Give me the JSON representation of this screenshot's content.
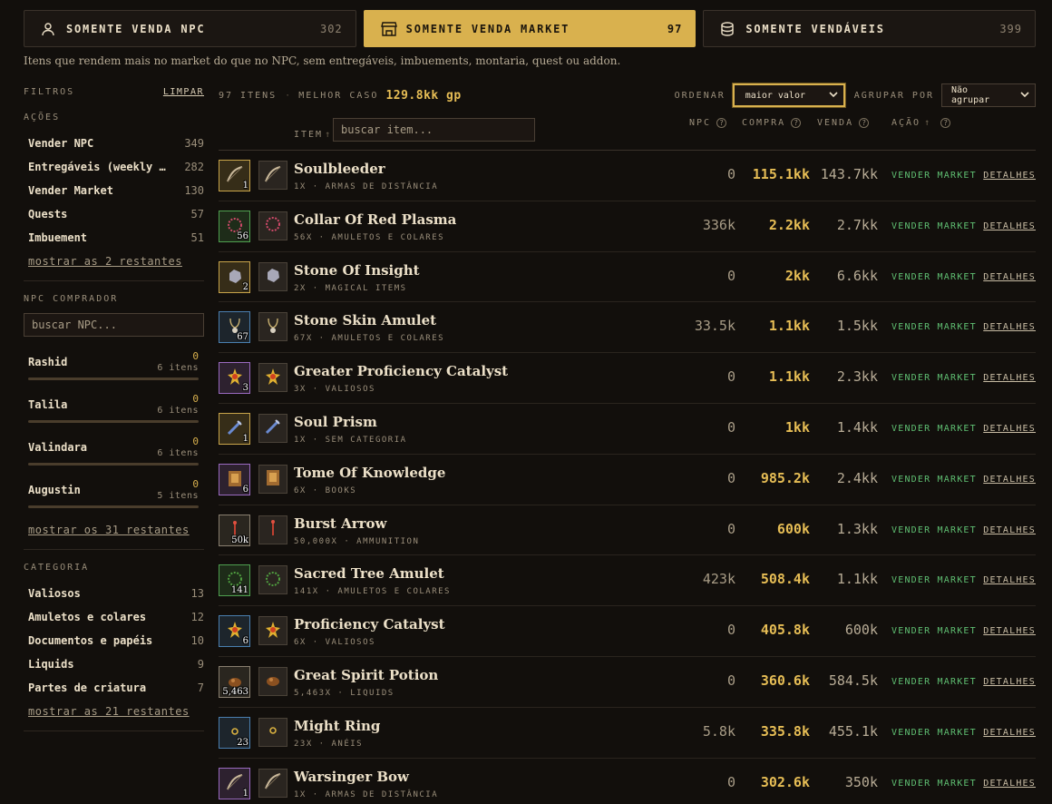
{
  "tabs": [
    {
      "label": "SOMENTE VENDA NPC",
      "count": "302",
      "icon": "user-icon",
      "active": false
    },
    {
      "label": "SOMENTE VENDA MARKET",
      "count": "97",
      "icon": "store-icon",
      "active": true
    },
    {
      "label": "SOMENTE VENDÁVEIS",
      "count": "399",
      "icon": "database-icon",
      "active": false
    }
  ],
  "subtitle": "Itens que rendem mais no market do que no NPC, sem entregáveis, imbuements, montaria, quest ou addon.",
  "sidebar": {
    "filters_title": "FILTROS",
    "clear_label": "LIMPAR",
    "actions": {
      "title": "AÇÕES",
      "items": [
        {
          "label": "Vender NPC",
          "count": "349"
        },
        {
          "label": "Entregáveis (weekly …",
          "count": "282"
        },
        {
          "label": "Vender Market",
          "count": "130"
        },
        {
          "label": "Quests",
          "count": "57"
        },
        {
          "label": "Imbuement",
          "count": "51"
        }
      ],
      "more": "mostrar as 2 restantes"
    },
    "npc": {
      "title": "NPC COMPRADOR",
      "placeholder": "buscar NPC...",
      "items": [
        {
          "name": "Rashid",
          "value": "0",
          "items": "6 itens"
        },
        {
          "name": "Talila",
          "value": "0",
          "items": "6 itens"
        },
        {
          "name": "Valindara",
          "value": "0",
          "items": "6 itens"
        },
        {
          "name": "Augustin",
          "value": "0",
          "items": "5 itens"
        }
      ],
      "more": "mostrar os 31 restantes"
    },
    "category": {
      "title": "CATEGORIA",
      "items": [
        {
          "label": "Valiosos",
          "count": "13"
        },
        {
          "label": "Amuletos e colares",
          "count": "12"
        },
        {
          "label": "Documentos e papéis",
          "count": "10"
        },
        {
          "label": "Liquids",
          "count": "9"
        },
        {
          "label": "Partes de criatura",
          "count": "7"
        }
      ],
      "more": "mostrar as 21 restantes"
    }
  },
  "toolbar": {
    "count": "97 ITENS",
    "best_label": "MELHOR CASO",
    "best_value": "129.8kk gp",
    "sort_label": "ORDENAR",
    "sort_value": "maior valor",
    "group_label": "AGRUPAR POR",
    "group_value": "Não agrupar"
  },
  "table": {
    "item_header": "ITEM",
    "item_arrow": "↑",
    "search_placeholder": "buscar item...",
    "col_npc": "NPC",
    "col_buy": "COMPRA",
    "col_sell": "VENDA",
    "col_action": "AÇÃO",
    "col_action_arrow": "↑",
    "qmark": "?",
    "action_label": "VENDER MARKET",
    "details_label": "DETALHES",
    "rows": [
      {
        "name": "Soulbleeder",
        "qty": "1",
        "meta": "1X · ARMAS DE DISTÂNCIA",
        "npc": "0",
        "buy": "115.1kk",
        "sell": "143.7kk",
        "color": "#c9a54a",
        "icon": "bow-icon"
      },
      {
        "name": "Collar Of Red Plasma",
        "qty": "56",
        "meta": "56X · AMULETOS E COLARES",
        "npc": "336k",
        "buy": "2.2kk",
        "sell": "2.7kk",
        "color": "#4fa04f",
        "icon": "necklace-icon"
      },
      {
        "name": "Stone Of Insight",
        "qty": "2",
        "meta": "2X · MAGICAL ITEMS",
        "npc": "0",
        "buy": "2kk",
        "sell": "6.6kk",
        "color": "#c9a54a",
        "icon": "stone-icon"
      },
      {
        "name": "Stone Skin Amulet",
        "qty": "67",
        "meta": "67X · AMULETOS E COLARES",
        "npc": "33.5k",
        "buy": "1.1kk",
        "sell": "1.5kk",
        "color": "#4a7fb0",
        "icon": "amulet-icon"
      },
      {
        "name": "Greater Proficiency Catalyst",
        "qty": "3",
        "meta": "3X · VALIOSOS",
        "npc": "0",
        "buy": "1.1kk",
        "sell": "2.3kk",
        "color": "#9a6ac0",
        "icon": "catalyst-icon"
      },
      {
        "name": "Soul Prism",
        "qty": "1",
        "meta": "1X · SEM CATEGORIA",
        "npc": "0",
        "buy": "1kk",
        "sell": "1.4kk",
        "color": "#c9a54a",
        "icon": "prism-icon"
      },
      {
        "name": "Tome Of Knowledge",
        "qty": "6",
        "meta": "6X · BOOKS",
        "npc": "0",
        "buy": "985.2k",
        "sell": "2.4kk",
        "color": "#9a6ac0",
        "icon": "book-icon"
      },
      {
        "name": "Burst Arrow",
        "qty": "50k",
        "meta": "50,000X · AMMUNITION",
        "npc": "0",
        "buy": "600k",
        "sell": "1.3kk",
        "color": "#8a8070",
        "icon": "arrow-icon"
      },
      {
        "name": "Sacred Tree Amulet",
        "qty": "141",
        "meta": "141X · AMULETOS E COLARES",
        "npc": "423k",
        "buy": "508.4k",
        "sell": "1.1kk",
        "color": "#4fa04f",
        "icon": "tree-amulet-icon"
      },
      {
        "name": "Proficiency Catalyst",
        "qty": "6",
        "meta": "6X · VALIOSOS",
        "npc": "0",
        "buy": "405.8k",
        "sell": "600k",
        "color": "#4a7fb0",
        "icon": "catalyst-icon"
      },
      {
        "name": "Great Spirit Potion",
        "qty": "5,463",
        "meta": "5,463X · LIQUIDS",
        "npc": "0",
        "buy": "360.6k",
        "sell": "584.5k",
        "color": "#8a8070",
        "icon": "potion-icon"
      },
      {
        "name": "Might Ring",
        "qty": "23",
        "meta": "23X · ANÉIS",
        "npc": "5.8k",
        "buy": "335.8k",
        "sell": "455.1k",
        "color": "#4a7fb0",
        "icon": "ring-icon"
      },
      {
        "name": "Warsinger Bow",
        "qty": "1",
        "meta": "1X · ARMAS DE DISTÂNCIA",
        "npc": "0",
        "buy": "302.6k",
        "sell": "350k",
        "color": "#9a6ac0",
        "icon": "bow-icon"
      }
    ]
  }
}
